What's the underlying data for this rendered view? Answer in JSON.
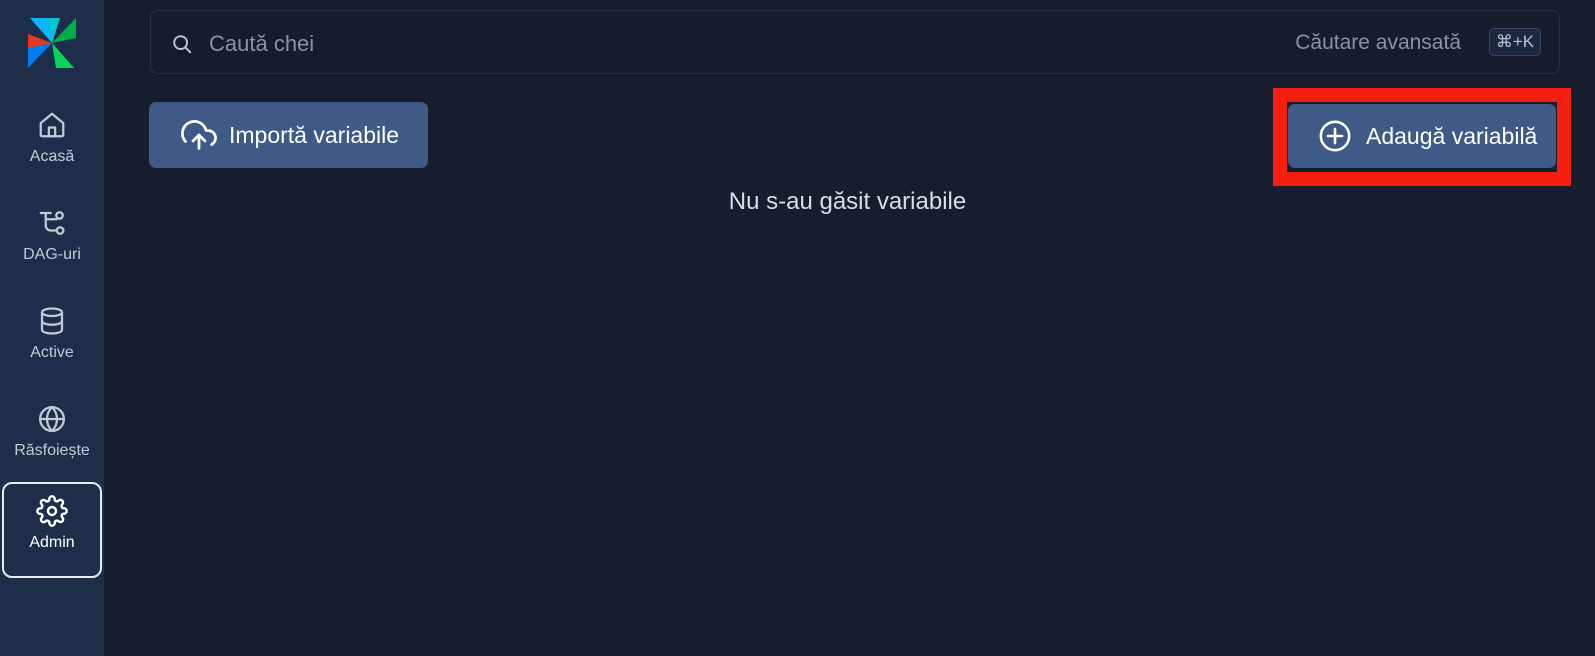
{
  "sidebar": {
    "items": [
      {
        "label": "Acasă",
        "icon": "home-icon"
      },
      {
        "label": "DAG-uri",
        "icon": "dag-icon"
      },
      {
        "label": "Active",
        "icon": "database-icon"
      },
      {
        "label": "Răsfoiește",
        "icon": "globe-icon"
      },
      {
        "label": "Admin",
        "icon": "gear-icon",
        "active": true
      }
    ]
  },
  "search": {
    "placeholder": "Caută chei",
    "advanced_label": "Căutare avansată",
    "shortcut": "⌘+K"
  },
  "toolbar": {
    "import_label": "Importă variabile",
    "add_label": "Adaugă variabilă"
  },
  "main": {
    "empty_message": "Nu s-au găsit variabile"
  },
  "colors": {
    "background": "#181d2e",
    "sidebar": "#1d2d4a",
    "button": "#3f5a86",
    "highlight": "#f41f10"
  }
}
